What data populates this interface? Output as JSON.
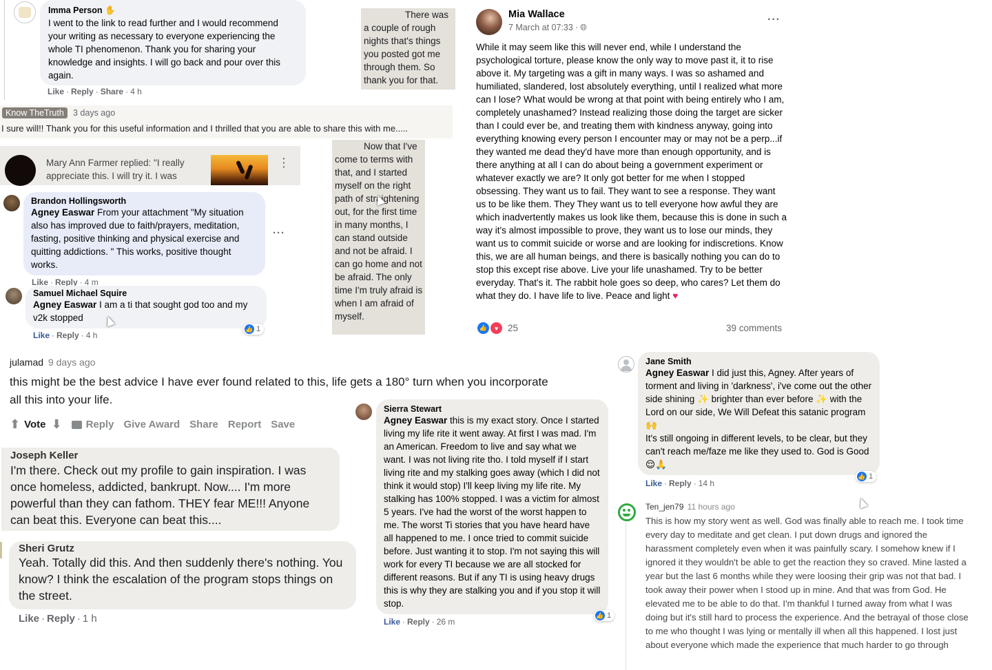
{
  "imma": {
    "name": "Imma Person",
    "name_icon": "waving-hand-icon",
    "text": "I went to the link to read further and I would recommend your writing as necessary to everyone experiencing the whole TI phenomenon. Thank you for sharing your knowledge and insights. I will go back and pour over this again.",
    "like": "Like",
    "reply": "Reply",
    "share": "Share",
    "time": "4 h"
  },
  "note1": {
    "text": "There was a couple of rough nights that's things you posted got me through them. So thank you for that."
  },
  "knowtruth": {
    "badge": "Know TheTruth",
    "time": "3 days ago",
    "text": "I sure will!! Thank you for this useful information and I thrilled that you are able to share this with me....."
  },
  "mary": {
    "text": "Mary Ann Farmer replied: \"I really appreciate this. I will try it. I was"
  },
  "note2": {
    "text": "Now that I've come to terms with that, and I started myself on the right path of straightening out, for the first time in many months, I can stand outside and not be afraid. I can go home and not be afraid. The only time I'm truly afraid is when I am afraid of myself."
  },
  "brandon": {
    "name": "Brandon Hollingsworth",
    "mention": "Agney Easwar",
    "text": " From your attachment \"My situation also has improved due to faith/prayers, meditation, fasting, positive thinking and physical exercise and quitting addictions. \" This works, positive thought works.",
    "like": "Like",
    "reply": "Reply",
    "time": "4 m"
  },
  "samuel": {
    "name": "Samuel Michael Squire",
    "mention": "Agney Easwar",
    "text": " I am a ti that sought god too and my v2k stopped",
    "like": "Like",
    "reply": "Reply",
    "time": "4 h",
    "reactions": "1"
  },
  "mia": {
    "name": "Mia Wallace",
    "date": "7 March at 07:33",
    "privacy_icon": "globe-icon",
    "menu_icon": "more-options-icon",
    "text": "While it may seem like this will never end, while I understand the psychological torture, please know the only way to move past it, it to rise above it. My targeting was a gift in many ways. I was so ashamed and humiliated, slandered, lost absolutely everything, until I realized what more can I lose? What would be wrong at that point with being entirely who I am, completely unashamed? Instead realizing those doing the target are sicker than I could ever be, and treating them with kindness anyway, going into everything knowing every person I encounter may or may not be a perp...if they wanted me dead they'd have more than enough opportunity, and is there anything at all I can do about being a government experiment or whatever exactly we are? It only got better for me when I stopped obsessing. They want us to fail. They want to see a response. They want us to be like them. They They want us to tell everyone how awful they are which inadvertently makes us look like them, because this is done in such a way it's almost impossible to prove, they want us to lose our minds, they want us to commit suicide or worse and  are looking for indiscretions. Know this, we are all human beings, and there is basically nothing you can do to stop this except rise above. Live your life unashamed. Try to be better everyday. That's it. The rabbit hole goes so deep, who cares? Let them do what they do. I have life to live. Peace and light",
    "reaction_count": "25",
    "comments": "39 comments"
  },
  "julamad": {
    "user": "julamad",
    "time": "9 days ago",
    "text": "this might be the best advice I have ever found related to this, life gets a 180° turn when you incorporate all this into your life.",
    "vote": "Vote",
    "reply": "Reply",
    "award": "Give Award",
    "share": "Share",
    "report": "Report",
    "save": "Save"
  },
  "joseph": {
    "name": "Joseph Keller",
    "text": "I'm there. Check out my profile to gain inspiration. I was once homeless, addicted, bankrupt. Now.... I'm more powerful than they can fathom. THEY fear ME!!! Anyone can beat this. Everyone can beat this...."
  },
  "sheri": {
    "name": "Sheri Grutz",
    "text": "Yeah. Totally did this. And then suddenly there's nothing. You know? I think the escalation of the program stops things on the street.",
    "like": "Like",
    "reply": "Reply",
    "time": "1 h"
  },
  "sierra": {
    "name": "Sierra Stewart",
    "mention": "Agney Easwar",
    "text": " this is my exact story. Once I started living my life rite it went away. At first I was mad. I'm an American. Freedom to live and say what we want. I was not living rite tho. I told myself if I start living rite and my stalking goes away (which I did not think it would stop) I'll keep living my life rite. My stalking has 100% stopped. I was a victim for almost 5 years. I've had the worst of the worst happen to me. The worst Ti stories that you have heard have all happened to me. I once tried to commit suicide before. Just wanting it to stop. I'm not saying this will work for every TI because we are all stocked for different reasons. But if any TI is using heavy drugs this is why they are stalking you and if you stop it will stop.",
    "like": "Like",
    "reply": "Reply",
    "time": "26 m",
    "reactions": "1"
  },
  "jane": {
    "name": "Jane Smith",
    "mention": "Agney Easwar",
    "text1": " I did just this, Agney. After years of torment and living in 'darkness', i've come out the other side shining ✨ brighter than ever before ✨ with the Lord on our side, We Will Defeat this satanic program 🙌",
    "text2": "It's still ongoing in different levels, to be clear, but they can't reach me/faze me like they used to. God is Good 😌🙏",
    "like": "Like",
    "reply": "Reply",
    "time": "14 h",
    "reactions": "1"
  },
  "ten": {
    "name": "Ten_jen79",
    "time": "11 hours ago",
    "text": "This is how my story went as well. God was finally able to reach me. I took time every day to meditate and get clean. I put down drugs and ignored the harassment completely even when it was painfully scary. I somehow knew if I ignored it they wouldn't be able to get the reaction they so craved. Mine lasted a year but the last 6 months while they were loosing their grip was not that bad. I took away their power when I stood up in mine. And that was from God. He elevated me to be able to do that. I'm thankful I turned away from what I was doing but it's still hard to process the experience. And the betrayal of those close to me who thought I was lying or mentally ill when all this happened. I lost just about everyone which made the experience that much harder to go through"
  }
}
